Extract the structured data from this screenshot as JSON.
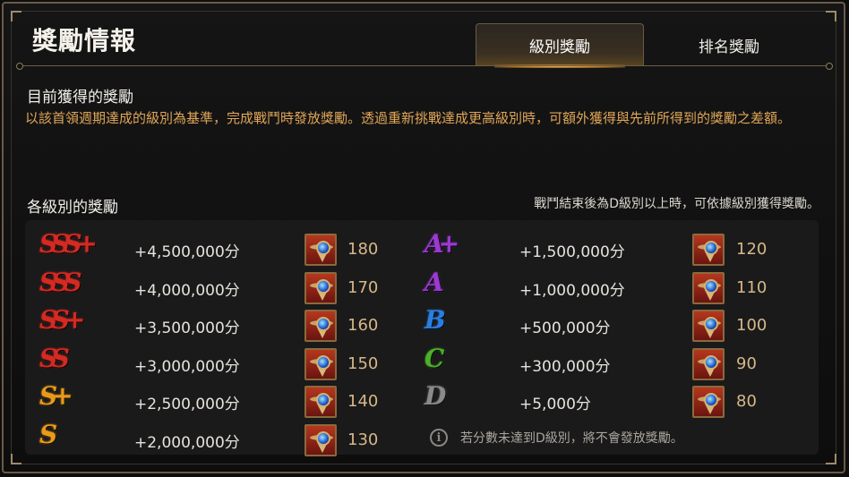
{
  "header": {
    "title": "獎勵情報",
    "tabs": [
      {
        "label": "級別獎勵",
        "active": true
      },
      {
        "label": "排名獎勵",
        "active": false
      }
    ]
  },
  "current": {
    "heading": "目前獲得的獎勵",
    "description": "以該首領週期達成的級別為基準，完成戰鬥時發放獎勵。透過重新挑戰達成更高級別時，可額外獲得與先前所得到的獎勵之差額。"
  },
  "grades": {
    "heading": "各級別的獎勵",
    "note": "戰鬥結束後為D級別以上時，可依據級別獲得獎勵。",
    "left": [
      {
        "grade": "SSS+",
        "points": "+4,500,000分",
        "qty": "180",
        "color": "#d42a22"
      },
      {
        "grade": "SSS",
        "points": "+4,000,000分",
        "qty": "170",
        "color": "#d42a22"
      },
      {
        "grade": "SS+",
        "points": "+3,500,000分",
        "qty": "160",
        "color": "#d42a22"
      },
      {
        "grade": "SS",
        "points": "+3,000,000分",
        "qty": "150",
        "color": "#d42a22"
      },
      {
        "grade": "S+",
        "points": "+2,500,000分",
        "qty": "140",
        "color": "#e89a1c"
      },
      {
        "grade": "S",
        "points": "+2,000,000分",
        "qty": "130",
        "color": "#e89a1c"
      }
    ],
    "right": [
      {
        "grade": "A+",
        "points": "+1,500,000分",
        "qty": "120",
        "color": "#9a3ad0"
      },
      {
        "grade": "A",
        "points": "+1,000,000分",
        "qty": "110",
        "color": "#9a3ad0"
      },
      {
        "grade": "B",
        "points": "+500,000分",
        "qty": "100",
        "color": "#2a7ee0"
      },
      {
        "grade": "C",
        "points": "+300,000分",
        "qty": "90",
        "color": "#4cb02a"
      },
      {
        "grade": "D",
        "points": "+5,000分",
        "qty": "80",
        "color": "#8a8a8a"
      }
    ],
    "info_icon": "info-icon",
    "info_text": "若分數未達到D級別，將不會發放獎勵。"
  }
}
